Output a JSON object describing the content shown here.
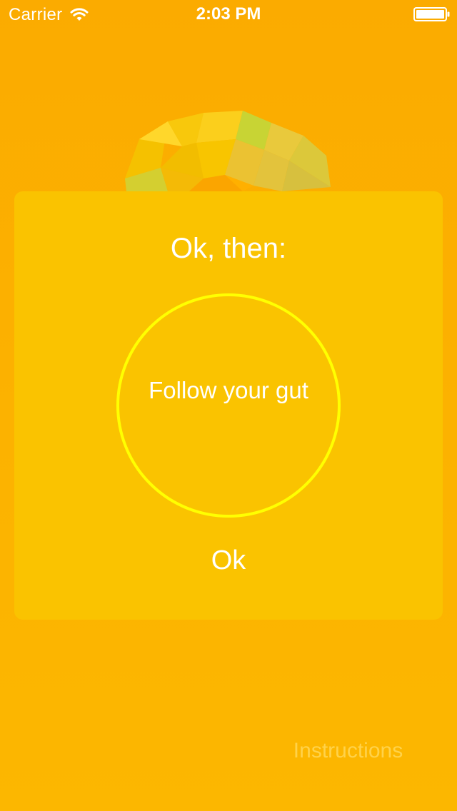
{
  "status_bar": {
    "carrier": "Carrier",
    "time": "2:03 PM",
    "wifi_icon": "wifi-icon",
    "battery_icon": "battery-icon"
  },
  "illustration": {
    "name": "low-poly-brain",
    "colors": [
      "#f9c400",
      "#ffd92e",
      "#c9d436",
      "#f3b500",
      "#e8c23a",
      "#fca200"
    ]
  },
  "card": {
    "title": "Ok, then:",
    "answer": "Follow your gut",
    "ok_label": "Ok",
    "circle_color": "#ffff00",
    "background": "#fac300"
  },
  "footer": {
    "instructions_label": "Instructions"
  },
  "colors": {
    "background": "#fbac00",
    "text": "#ffffff",
    "link_faded": "#ffd24a"
  }
}
